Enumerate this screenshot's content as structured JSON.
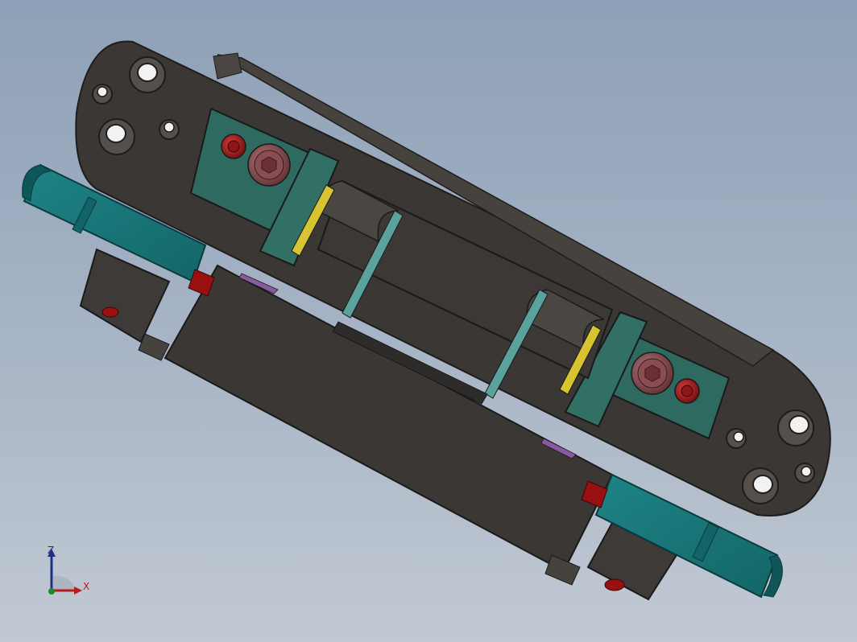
{
  "viewport": {
    "background_top": "#8ea0b7",
    "background_bottom": "#c1c9d3"
  },
  "model": {
    "body_color": "#3b3835",
    "plate_color": "#2f6a61",
    "teal_color": "#17787b",
    "screw_color": "#7a3c3f",
    "red_color": "#9a1010",
    "yellow_color": "#d8c431"
  },
  "triad": {
    "z_label": "Z",
    "x_label": "X",
    "z_color": "#1d2f86",
    "x_color": "#b51c1c",
    "y_color": "#1d8a2c"
  }
}
